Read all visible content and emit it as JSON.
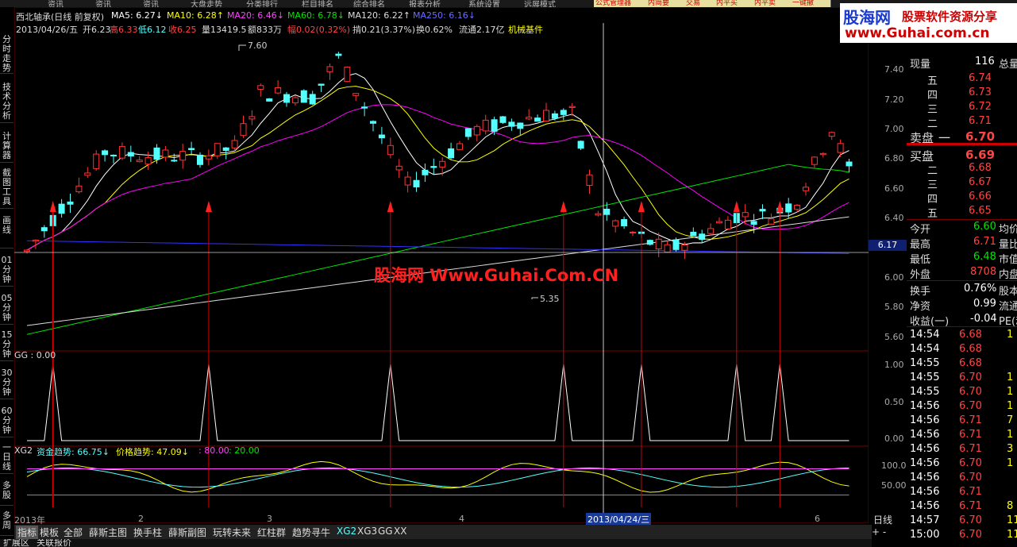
{
  "top_tabs": [
    "资讯",
    "资讯",
    "资讯",
    "大盘走势",
    "分类排行",
    "栏目排名",
    "综合排名",
    "报表分析",
    "系统设置",
    "远展模式"
  ],
  "tool_buttons": [
    "公式管理器",
    "内简要",
    "交易",
    "内平买",
    "内平卖",
    "一键撤"
  ],
  "sidebar": [
    "分时走势",
    "技术分析",
    "计算器",
    "截图工具",
    "画线",
    "01分钟",
    "05分钟",
    "15分钟",
    "30分钟",
    "60分钟",
    "一日线",
    "多股",
    "多周"
  ],
  "header": {
    "title": "西北轴承(日线 前复权)",
    "ma5": "MA5: 6.27↓",
    "ma10": "MA10: 6.28↑",
    "ma20": "MA20: 6.46↓",
    "ma60": "MA60: 6.78↓",
    "ma120": "MA120: 6.22↑",
    "ma250": "MA250: 6.16↓",
    "line2_date": "2013/04/26/五",
    "line2_open": "开6.23",
    "line2_high": "高6.33",
    "line2_low": "低6.12",
    "line2_close": "收6.25",
    "line2_vol": "量13419.5",
    "line2_amt": "额833万",
    "line2_chg": "幅0.02(0.32%)",
    "line2_amp": "掯0.21(3.37%)",
    "line2_turn": "换0.62%",
    "line2_float": "流通2.17亿",
    "line2_ind": "机械基件"
  },
  "price_axis": [
    "7.40",
    "7.20",
    "7.00",
    "6.80",
    "6.60",
    "6.40",
    "6.20",
    "6.00",
    "5.80",
    "5.60"
  ],
  "price_marker": "6.17",
  "annot_high": "7.60",
  "annot_low": "5.35",
  "watermark": "股海网 Www.Guhai.Com.CN",
  "gg_label": "GG : 0.00",
  "gg_axis": [
    "1.00",
    "0.50",
    "0.00"
  ],
  "xg2": {
    "name": "XG2",
    "zj": "资金趋势: 66.75↓",
    "jg": "价格趋势: 47.09↓",
    "v80": ": 80.00",
    "v20": ": 20.00"
  },
  "xg2_axis": [
    "100.0",
    "50.00"
  ],
  "time_axis": [
    "2013年",
    "2",
    "3",
    "4",
    "6"
  ],
  "cursor_date": "2013/04/24/三",
  "period": "日线",
  "bottom_tabs": [
    "指标",
    "模板",
    "全部",
    "薛斯主图",
    "换手柱",
    "薛斯副图",
    "玩转未来",
    "红柱群",
    "趋势寻牛",
    "XG2",
    "XG3",
    "GG",
    "XX"
  ],
  "bottom_extra": [
    "扩展区",
    "关联报价"
  ],
  "logo": {
    "main": "股海网",
    "sub": "股票软件资源分享",
    "url": "www.Guhai.com.cn"
  },
  "right": {
    "xianliang_label": "现量",
    "xianliang": "116",
    "zongliang_label": "总量",
    "sell": [
      [
        "五",
        "6.74"
      ],
      [
        "四",
        "6.73"
      ],
      [
        "三",
        "6.72"
      ],
      [
        "二",
        "6.71"
      ],
      [
        "一",
        "6.70"
      ]
    ],
    "sell_label": "卖盘",
    "buy_label": "买盘",
    "buy": [
      [
        "一",
        "6.69"
      ],
      [
        "二",
        "6.68"
      ],
      [
        "三",
        "6.67"
      ],
      [
        "四",
        "6.66"
      ],
      [
        "五",
        "6.65"
      ]
    ],
    "stats": [
      [
        "今开",
        "6.60",
        "均价"
      ],
      [
        "最高",
        "6.71",
        "量比"
      ],
      [
        "最低",
        "6.48",
        "市值"
      ],
      [
        "外盘",
        "8708",
        "内盘"
      ]
    ],
    "stats2": [
      [
        "换手",
        "0.76%",
        "股本"
      ],
      [
        "净资",
        "0.99",
        "流通"
      ],
      [
        "收益(一)",
        "-0.04",
        "PE(动"
      ]
    ],
    "ticks": [
      [
        "14:54",
        "6.68",
        "1"
      ],
      [
        "14:54",
        "6.68",
        ""
      ],
      [
        "14:55",
        "6.68",
        ""
      ],
      [
        "14:55",
        "6.70",
        "1"
      ],
      [
        "14:55",
        "6.70",
        "1"
      ],
      [
        "14:56",
        "6.70",
        "1"
      ],
      [
        "14:56",
        "6.71",
        "7"
      ],
      [
        "14:56",
        "6.71",
        "1"
      ],
      [
        "14:56",
        "6.71",
        "3"
      ],
      [
        "14:56",
        "6.70",
        "1"
      ],
      [
        "14:56",
        "6.70",
        ""
      ],
      [
        "14:56",
        "6.71",
        ""
      ],
      [
        "14:56",
        "6.71",
        "8"
      ],
      [
        "14:57",
        "6.70",
        "11"
      ],
      [
        "15:00",
        "6.70",
        "11"
      ]
    ]
  },
  "colors": {
    "up": "#ff3232",
    "down": "#54ffff",
    "ma5": "#ffffff",
    "ma10": "#ffff00",
    "ma20": "#ff00ff",
    "ma60": "#00e600",
    "ma120": "#dddddd",
    "ma250": "#3232ff"
  }
}
